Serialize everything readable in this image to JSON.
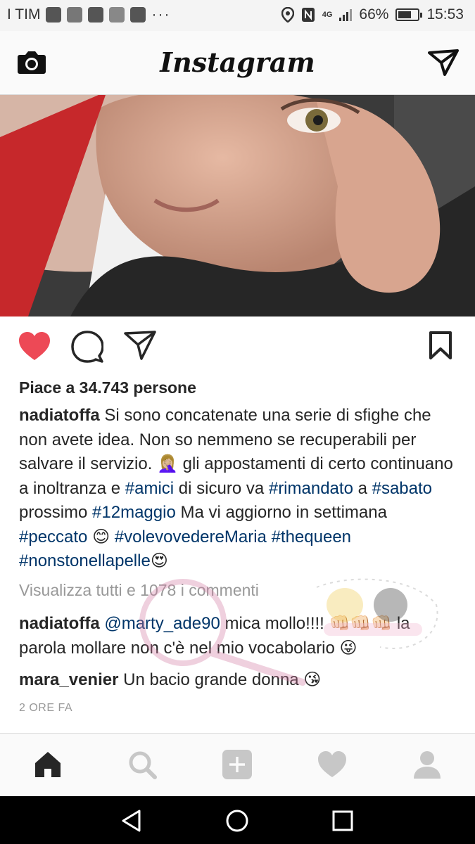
{
  "status_bar": {
    "carrier": "I TIM",
    "network": "4G",
    "battery": "66%",
    "battery_level": 0.66,
    "time": "15:53",
    "more": "···"
  },
  "header": {
    "title": "Instagram",
    "camera_icon": "camera-icon",
    "direct_icon": "paper-plane-icon"
  },
  "post": {
    "likes": "Piace a 34.743 persone",
    "liked": true,
    "caption": {
      "user": "nadiatoffa",
      "t1": " Si sono concatenate una serie di sfighe che non avete idea. Non so nemmeno se recuperabili per salvare il servizio. 🤦🏼‍♀️ gli appostamenti di certo continuano a inoltranza e ",
      "h1": "#amici",
      "t2": " di sicuro va ",
      "h2": "#rimandato",
      "t3": " a ",
      "h3": "#sabato",
      "t4": " prossimo ",
      "h4": "#12maggio",
      "t5": " Ma vi aggiorno in settimana ",
      "h5": "#peccato",
      "t6": " 😊 ",
      "h6": "#volevovedereMaria",
      "t7": " ",
      "h7": "#thequeen",
      "t8": " ",
      "h8": "#nonstonellapelle",
      "t9": "😍"
    },
    "view_all_comments": "Visualizza tutti e 1078 i commenti",
    "comments": [
      {
        "user": "nadiatoffa",
        "mention": "@marty_ade90",
        "text": " mica mollo!!!! 👊🏻👊🏻👊🏻 la parola mollare non c'è nel mio vocabolario 😜"
      },
      {
        "user": "mara_venier",
        "mention": "",
        "text": " Un bacio grande donna 😘"
      }
    ],
    "time_ago": "2 ORE FA"
  },
  "bottom_nav": [
    "home-icon",
    "search-icon",
    "add-post-icon",
    "activity-heart-icon",
    "profile-icon"
  ],
  "system_nav": [
    "back-icon",
    "home-circle-icon",
    "recents-icon"
  ],
  "colors": {
    "heart": "#ed4956",
    "hashtag": "#003569",
    "muted": "#999999"
  }
}
